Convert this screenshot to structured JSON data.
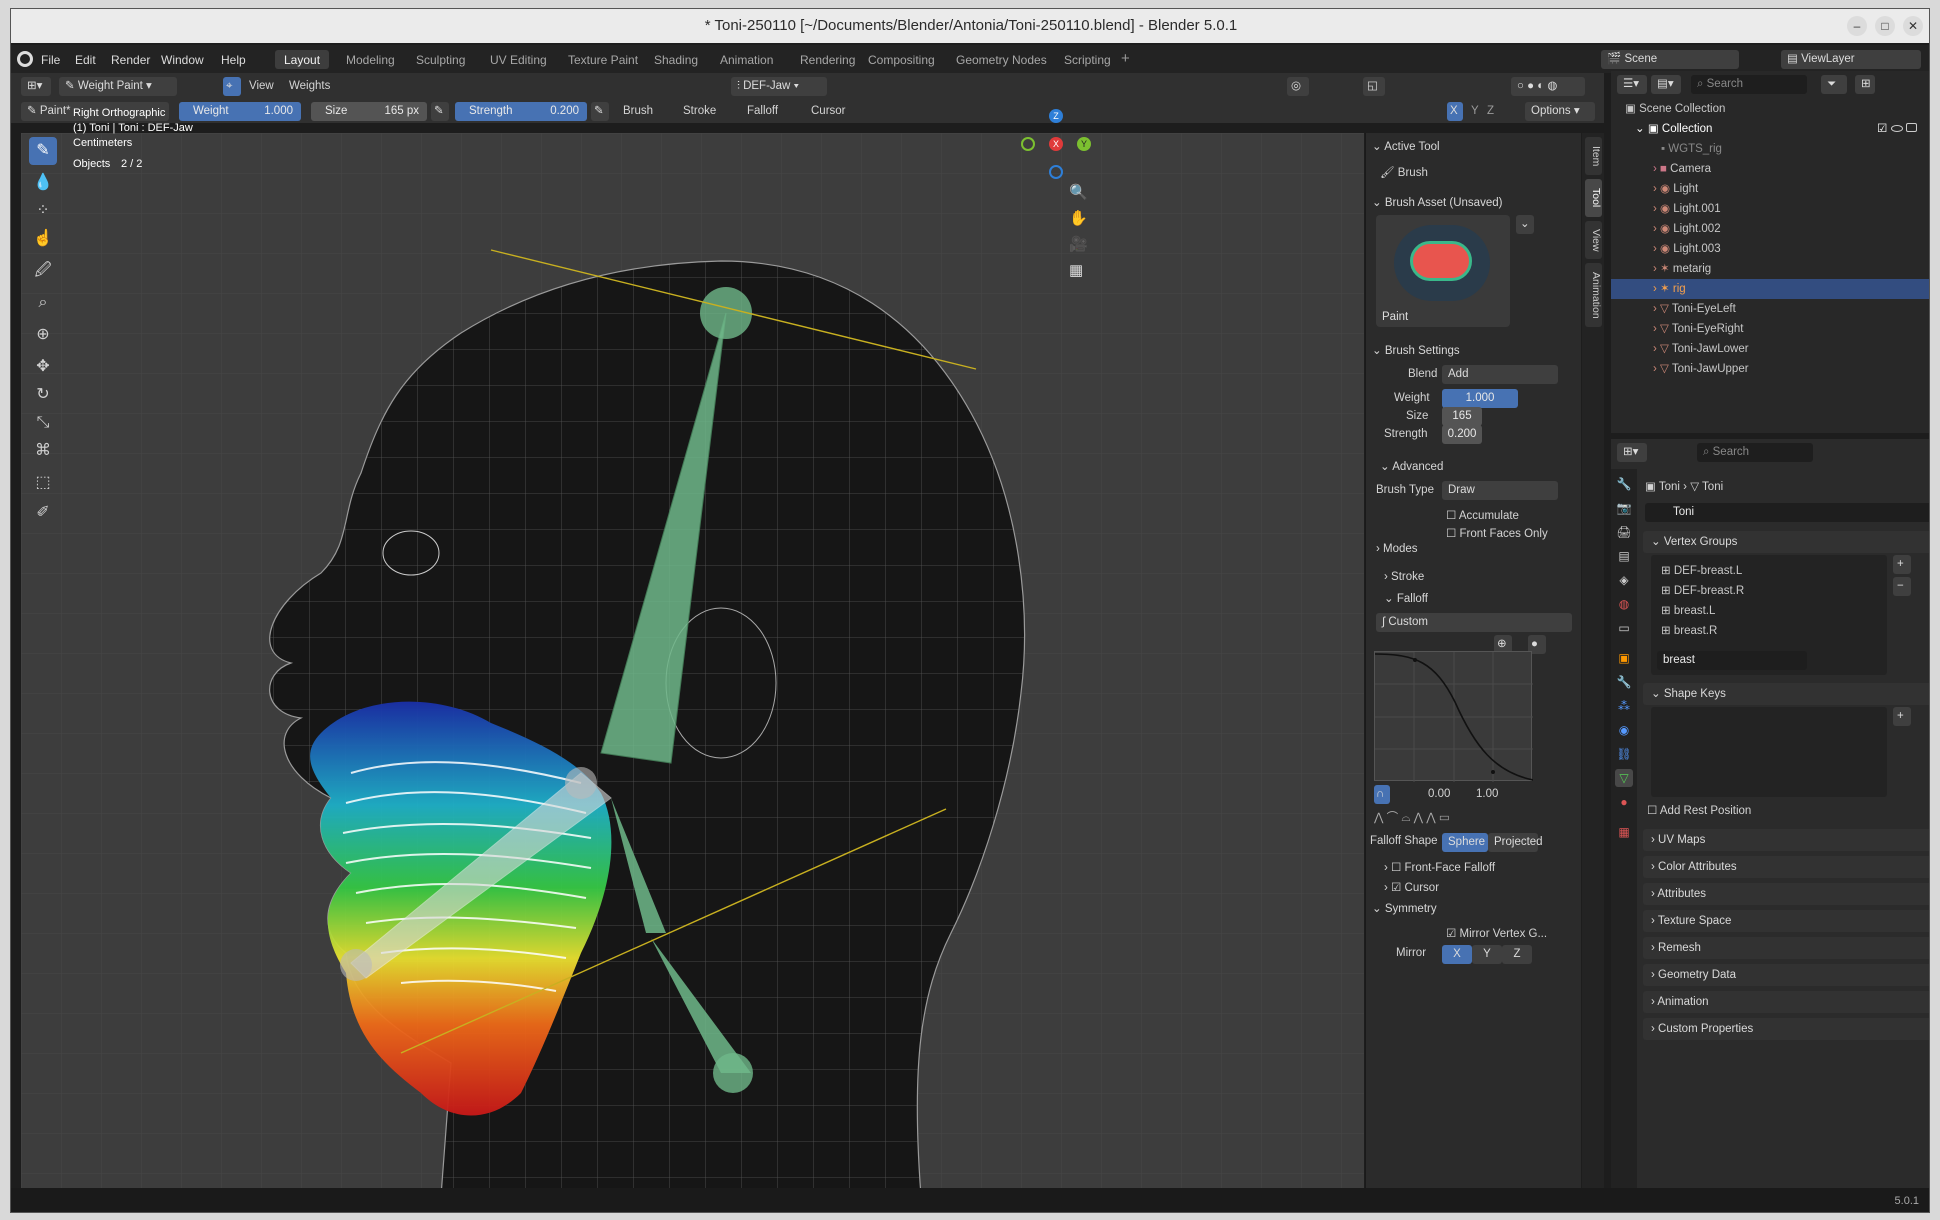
{
  "window": {
    "title": "* Toni-250110 [~/Documents/Blender/Antonia/Toni-250110.blend] - Blender 5.0.1"
  },
  "menus": [
    "File",
    "Edit",
    "Render",
    "Window",
    "Help"
  ],
  "workspaces": [
    "Layout",
    "Modeling",
    "Sculpting",
    "UV Editing",
    "Texture Paint",
    "Shading",
    "Animation",
    "Rendering",
    "Compositing",
    "Geometry Nodes",
    "Scripting"
  ],
  "scene": {
    "label": "Scene",
    "viewlayer": "ViewLayer"
  },
  "viewport_header": {
    "mode": "Weight Paint",
    "view": "View",
    "weights": "Weights",
    "bone": "DEF-Jaw",
    "x": "X",
    "y": "Y",
    "z": "Z",
    "options": "Options"
  },
  "tool_settings": {
    "brush_name": "Paint*",
    "weight_label": "Weight",
    "weight_value": "1.000",
    "size_label": "Size",
    "size_value": "165 px",
    "strength_label": "Strength",
    "strength_value": "0.200",
    "brush": "Brush",
    "stroke": "Stroke",
    "falloff": "Falloff",
    "cursor": "Cursor"
  },
  "overlay_text": {
    "view": "Right Orthographic",
    "object": "(1) Toni | Toni : DEF-Jaw",
    "units": "Centimeters",
    "objects_label": "Objects",
    "objects_value": "2 / 2"
  },
  "gizmo": {
    "x": "X",
    "y": "Y",
    "z": "Z"
  },
  "npanel": {
    "tabs": [
      "Item",
      "Tool",
      "View",
      "Animation"
    ],
    "active_tool_hd": "Active Tool",
    "active_tool": "Brush",
    "brush_asset_hd": "Brush Asset (Unsaved)",
    "preview_label": "Paint",
    "brush_settings_hd": "Brush Settings",
    "blend_label": "Blend",
    "blend_value": "Add",
    "weight_label": "Weight",
    "weight_value": "1.000",
    "size_label": "Size",
    "size_value": "165",
    "strength_label": "Strength",
    "strength_value": "0.200",
    "advanced": "Advanced",
    "brush_type_label": "Brush Type",
    "brush_type_value": "Draw",
    "accumulate": "Accumulate",
    "front_faces": "Front Faces Only",
    "modes": "Modes",
    "stroke": "Stroke",
    "falloff": "Falloff",
    "custom": "Custom",
    "curve_min": "0.00",
    "curve_max": "1.00",
    "falloff_shape_label": "Falloff Shape",
    "sphere": "Sphere",
    "projected": "Projected",
    "front_face_falloff": "Front-Face Falloff",
    "cursor": "Cursor",
    "symmetry": "Symmetry",
    "mirror_vg": "Mirror Vertex G...",
    "mirror_label": "Mirror",
    "mx": "X",
    "my": "Y",
    "mz": "Z"
  },
  "outliner": {
    "search": "Search",
    "scene_collection": "Scene Collection",
    "collection": "Collection",
    "items": [
      "WGTS_rig",
      "Camera",
      "Light",
      "Light.001",
      "Light.002",
      "Light.003",
      "metarig",
      "rig",
      "Toni-EyeLeft",
      "Toni-EyeRight",
      "Toni-JawLower",
      "Toni-JawUpper"
    ]
  },
  "properties": {
    "search": "Search",
    "breadcrumb_a": "Toni",
    "breadcrumb_b": "Toni",
    "data_name": "Toni",
    "vertex_groups_hd": "Vertex Groups",
    "vertex_groups": [
      "DEF-breast.L",
      "DEF-breast.R",
      "breast.L",
      "breast.R"
    ],
    "filter_value": "breast",
    "shape_keys_hd": "Shape Keys",
    "add_rest": "Add Rest Position",
    "panels": [
      "UV Maps",
      "Color Attributes",
      "Attributes",
      "Texture Space",
      "Remesh",
      "Geometry Data",
      "Animation",
      "Custom Properties"
    ]
  },
  "status": {
    "version": "5.0.1"
  },
  "colors": {
    "accent": "#4772b3",
    "bone": "#6fb88a",
    "selected_row": "#334d80"
  }
}
